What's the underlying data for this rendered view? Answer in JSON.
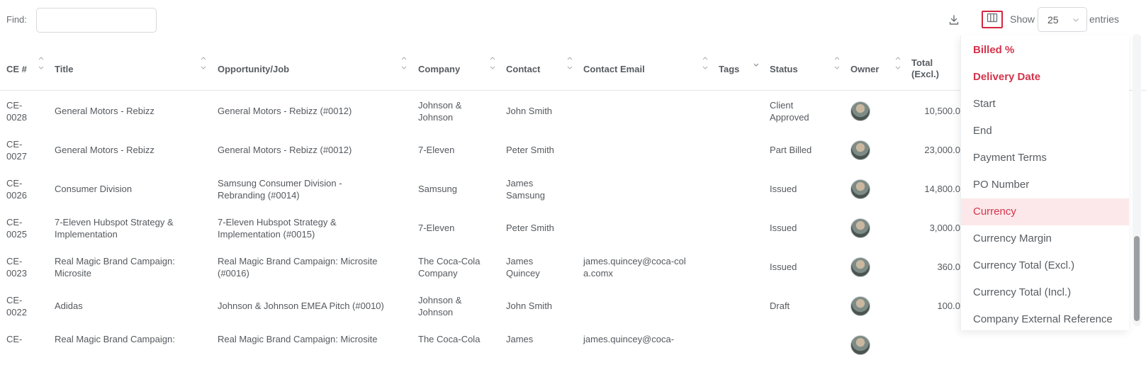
{
  "toolbar": {
    "find_label": "Find:",
    "find_value": "",
    "show_label": "Show",
    "entries_value": "25",
    "entries_label": "entries",
    "accent_color": "#d4263f"
  },
  "table": {
    "columns": [
      "CE #",
      "Title",
      "Opportunity/Job",
      "Company",
      "Contact",
      "Contact Email",
      "Tags",
      "Status",
      "Owner",
      "Total (Excl.)"
    ],
    "rows": [
      {
        "ce": "CE-0028",
        "title": "General Motors - Rebizz",
        "opportunity": "General Motors - Rebizz (#0012)",
        "company": "Johnson & Johnson",
        "contact": "John Smith",
        "email": "",
        "tags": "",
        "status": "Client Approved",
        "total": "10,500.0"
      },
      {
        "ce": "CE-0027",
        "title": "General Motors - Rebizz",
        "opportunity": "General Motors - Rebizz (#0012)",
        "company": "7-Eleven",
        "contact": "Peter Smith",
        "email": "",
        "tags": "",
        "status": "Part Billed",
        "total": "23,000.0"
      },
      {
        "ce": "CE-0026",
        "title": "Consumer Division",
        "opportunity": "Samsung Consumer Division - Rebranding (#0014)",
        "company": "Samsung",
        "contact": "James Samsung",
        "email": "",
        "tags": "",
        "status": "Issued",
        "total": "14,800.0"
      },
      {
        "ce": "CE-0025",
        "title": "7-Eleven Hubspot Strategy & Implementation",
        "opportunity": "7-Eleven Hubspot Strategy & Implementation (#0015)",
        "company": "7-Eleven",
        "contact": "Peter Smith",
        "email": "",
        "tags": "",
        "status": "Issued",
        "total": "3,000.0"
      },
      {
        "ce": "CE-0023",
        "title": "Real Magic Brand Campaign: Microsite",
        "opportunity": "Real Magic Brand Campaign: Microsite (#0016)",
        "company": "The Coca-Cola Company",
        "contact": "James Quincey",
        "email": "james.quincey@coca-cola.comx",
        "tags": "",
        "status": "Issued",
        "total": "360.0"
      },
      {
        "ce": "CE-0022",
        "title": "Adidas",
        "opportunity": "Johnson & Johnson EMEA Pitch (#0010)",
        "company": "Johnson & Johnson",
        "contact": "John Smith",
        "email": "",
        "tags": "",
        "status": "Draft",
        "total": "100.0"
      },
      {
        "ce": "CE-",
        "title": "Real Magic Brand Campaign:",
        "opportunity": "Real Magic Brand Campaign: Microsite",
        "company": "The Coca-Cola",
        "contact": "James",
        "email": "james.quincey@coca-",
        "tags": "",
        "status": "",
        "total": ""
      }
    ]
  },
  "column_menu": {
    "items": [
      {
        "label": "Billed %",
        "state": "selected"
      },
      {
        "label": "Delivery Date",
        "state": "selected"
      },
      {
        "label": "Start",
        "state": ""
      },
      {
        "label": "End",
        "state": ""
      },
      {
        "label": "Payment Terms",
        "state": ""
      },
      {
        "label": "PO Number",
        "state": ""
      },
      {
        "label": "Currency",
        "state": "hover"
      },
      {
        "label": "Currency Margin",
        "state": ""
      },
      {
        "label": "Currency Total (Excl.)",
        "state": ""
      },
      {
        "label": "Currency Total (Incl.)",
        "state": ""
      },
      {
        "label": "Company External Reference",
        "state": ""
      }
    ],
    "selected_color": "#d4334b",
    "hover_background": "#fce8ea"
  }
}
